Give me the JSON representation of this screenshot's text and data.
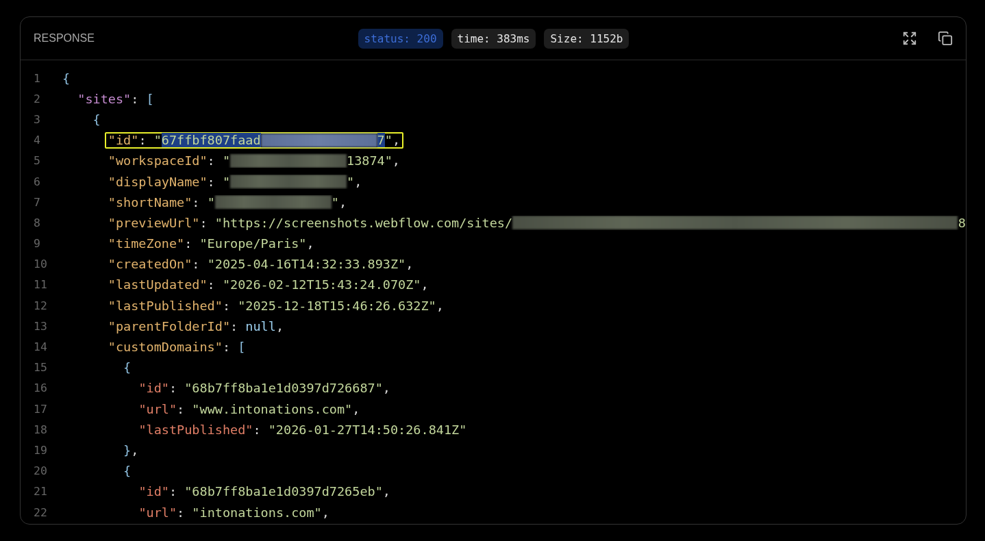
{
  "panel": {
    "title": "RESPONSE",
    "badges": [
      {
        "text": "status: 200",
        "kind": "status"
      },
      {
        "text": "time: 383ms",
        "kind": "info"
      },
      {
        "text": "Size: 1152b",
        "kind": "info"
      }
    ]
  },
  "code": {
    "lines": [
      {
        "number": "1",
        "tokens": [
          {
            "kind": "bracket",
            "text": "{"
          }
        ],
        "children": [
          {
            "number": "2",
            "tokens": [
              {
                "kind": "rootkey",
                "text": "\"sites\""
              },
              {
                "kind": "punct",
                "text": ": "
              },
              {
                "kind": "bracket",
                "text": "["
              }
            ],
            "children": [
              {
                "number": "3",
                "tokens": [
                  {
                    "kind": "bracket",
                    "text": "{"
                  }
                ],
                "children": [
                  {
                    "number": "4",
                    "boxed": true,
                    "tokens": [
                      {
                        "kind": "key",
                        "text": "\"id\""
                      },
                      {
                        "kind": "punct",
                        "text": ": "
                      },
                      {
                        "kind": "string",
                        "text": "\"",
                        "selected": false
                      },
                      {
                        "kind": "string",
                        "text": "67ffbf807faad",
                        "selected": true
                      },
                      {
                        "kind": "redacted",
                        "selected": true
                      },
                      {
                        "kind": "string",
                        "text": "7",
                        "selected": true
                      },
                      {
                        "kind": "string",
                        "text": "\"",
                        "selected": false
                      },
                      {
                        "kind": "punct",
                        "text": ","
                      }
                    ]
                  },
                  {
                    "number": "5",
                    "tokens": [
                      {
                        "kind": "key",
                        "text": "\"workspaceId\""
                      },
                      {
                        "kind": "punct",
                        "text": ": "
                      },
                      {
                        "kind": "string",
                        "text": "\""
                      },
                      {
                        "kind": "redacted"
                      },
                      {
                        "kind": "string",
                        "text": "13874\""
                      },
                      {
                        "kind": "punct",
                        "text": ","
                      }
                    ]
                  },
                  {
                    "number": "6",
                    "tokens": [
                      {
                        "kind": "key",
                        "text": "\"displayName\""
                      },
                      {
                        "kind": "punct",
                        "text": ": "
                      },
                      {
                        "kind": "string",
                        "text": "\""
                      },
                      {
                        "kind": "redacted"
                      },
                      {
                        "kind": "string",
                        "text": "\""
                      },
                      {
                        "kind": "punct",
                        "text": ","
                      }
                    ]
                  },
                  {
                    "number": "7",
                    "tokens": [
                      {
                        "kind": "key",
                        "text": "\"shortName\""
                      },
                      {
                        "kind": "punct",
                        "text": ": "
                      },
                      {
                        "kind": "string",
                        "text": "\""
                      },
                      {
                        "kind": "redacted"
                      },
                      {
                        "kind": "string",
                        "text": "\""
                      },
                      {
                        "kind": "punct",
                        "text": ","
                      }
                    ]
                  },
                  {
                    "number": "8",
                    "clipped": true,
                    "tokens": [
                      {
                        "kind": "key",
                        "text": "\"previewUrl\""
                      },
                      {
                        "kind": "punct",
                        "text": ": "
                      },
                      {
                        "kind": "string",
                        "text": "\"https://screenshots.webflow.com/sites/"
                      },
                      {
                        "kind": "redacted"
                      },
                      {
                        "kind": "string",
                        "text": "8"
                      }
                    ]
                  },
                  {
                    "number": "9",
                    "tokens": [
                      {
                        "kind": "key",
                        "text": "\"timeZone\""
                      },
                      {
                        "kind": "punct",
                        "text": ": "
                      },
                      {
                        "kind": "string",
                        "text": "\"Europe/Paris\""
                      },
                      {
                        "kind": "punct",
                        "text": ","
                      }
                    ]
                  },
                  {
                    "number": "10",
                    "tokens": [
                      {
                        "kind": "key",
                        "text": "\"createdOn\""
                      },
                      {
                        "kind": "punct",
                        "text": ": "
                      },
                      {
                        "kind": "string",
                        "text": "\"2025-04-16T14:32:33.893Z\""
                      },
                      {
                        "kind": "punct",
                        "text": ","
                      }
                    ]
                  },
                  {
                    "number": "11",
                    "tokens": [
                      {
                        "kind": "key",
                        "text": "\"lastUpdated\""
                      },
                      {
                        "kind": "punct",
                        "text": ": "
                      },
                      {
                        "kind": "string",
                        "text": "\"2026-02-12T15:43:24.070Z\""
                      },
                      {
                        "kind": "punct",
                        "text": ","
                      }
                    ]
                  },
                  {
                    "number": "12",
                    "tokens": [
                      {
                        "kind": "key",
                        "text": "\"lastPublished\""
                      },
                      {
                        "kind": "punct",
                        "text": ": "
                      },
                      {
                        "kind": "string",
                        "text": "\"2025-12-18T15:46:26.632Z\""
                      },
                      {
                        "kind": "punct",
                        "text": ","
                      }
                    ]
                  },
                  {
                    "number": "13",
                    "tokens": [
                      {
                        "kind": "key",
                        "text": "\"parentFolderId\""
                      },
                      {
                        "kind": "punct",
                        "text": ": "
                      },
                      {
                        "kind": "literal",
                        "text": "null"
                      },
                      {
                        "kind": "punct",
                        "text": ","
                      }
                    ]
                  },
                  {
                    "number": "14",
                    "tokens": [
                      {
                        "kind": "key",
                        "text": "\"customDomains\""
                      },
                      {
                        "kind": "punct",
                        "text": ": "
                      },
                      {
                        "kind": "bracket",
                        "text": "["
                      }
                    ],
                    "children": [
                      {
                        "number": "15",
                        "tokens": [
                          {
                            "kind": "bracket",
                            "text": "{"
                          }
                        ],
                        "children": [
                          {
                            "number": "16",
                            "tokens": [
                              {
                                "kind": "subkey",
                                "text": "\"id\""
                              },
                              {
                                "kind": "punct",
                                "text": ": "
                              },
                              {
                                "kind": "string",
                                "text": "\"68b7ff8ba1e1d0397d726687\""
                              },
                              {
                                "kind": "punct",
                                "text": ","
                              }
                            ]
                          },
                          {
                            "number": "17",
                            "tokens": [
                              {
                                "kind": "subkey",
                                "text": "\"url\""
                              },
                              {
                                "kind": "punct",
                                "text": ": "
                              },
                              {
                                "kind": "string",
                                "text": "\"www.intonations.com\""
                              },
                              {
                                "kind": "punct",
                                "text": ","
                              }
                            ]
                          },
                          {
                            "number": "18",
                            "tokens": [
                              {
                                "kind": "subkey",
                                "text": "\"lastPublished\""
                              },
                              {
                                "kind": "punct",
                                "text": ": "
                              },
                              {
                                "kind": "string",
                                "text": "\"2026-01-27T14:50:26.841Z\""
                              }
                            ]
                          }
                        ]
                      },
                      {
                        "number": "19",
                        "tokens": [
                          {
                            "kind": "bracket",
                            "text": "}"
                          },
                          {
                            "kind": "punct",
                            "text": ","
                          }
                        ]
                      },
                      {
                        "number": "20",
                        "tokens": [
                          {
                            "kind": "bracket",
                            "text": "{"
                          }
                        ],
                        "children": [
                          {
                            "number": "21",
                            "tokens": [
                              {
                                "kind": "subkey",
                                "text": "\"id\""
                              },
                              {
                                "kind": "punct",
                                "text": ": "
                              },
                              {
                                "kind": "string",
                                "text": "\"68b7ff8ba1e1d0397d7265eb\""
                              },
                              {
                                "kind": "punct",
                                "text": ","
                              }
                            ]
                          },
                          {
                            "number": "22",
                            "tokens": [
                              {
                                "kind": "subkey",
                                "text": "\"url\""
                              },
                              {
                                "kind": "punct",
                                "text": ": "
                              },
                              {
                                "kind": "string",
                                "text": "\"intonations.com\""
                              },
                              {
                                "kind": "punct",
                                "text": ","
                              }
                            ]
                          }
                        ]
                      }
                    ]
                  }
                ]
              }
            ]
          }
        ]
      }
    ]
  }
}
